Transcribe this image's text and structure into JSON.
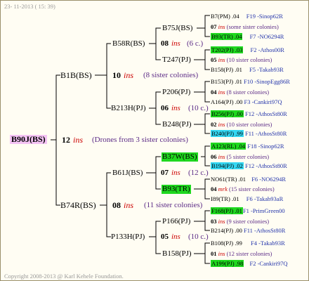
{
  "header": {
    "date": "23- 11-2013 ( 15: 39)"
  },
  "footer": {
    "copyright": "Copyright 2008-2013 @ Karl Kehele Foundation."
  },
  "root": {
    "name": "B90J(BS)",
    "count": "12",
    "ins": "ins",
    "note": "(Drones from 3 sister colonies)"
  },
  "gen1": [
    {
      "name": "B1B(BS)",
      "count": "10",
      "ins": "ins",
      "note": "(8 sister colonies)"
    },
    {
      "name": "B74R(BS)",
      "count": "08",
      "ins": "ins",
      "note": "(11 sister colonies)"
    }
  ],
  "gen2": [
    {
      "name": "B58R(BS)",
      "count": "08",
      "ins": "ins",
      "note": "(6 c.)"
    },
    {
      "name": "B213H(PJ)",
      "count": "06",
      "ins": "ins",
      "note": "(10 c.)"
    },
    {
      "name": "B61J(BS)",
      "count": "07",
      "ins": "ins",
      "note": "(12 c.)"
    },
    {
      "name": "P133H(PJ)",
      "count": "05",
      "ins": "ins",
      "note": "(10 c.)"
    }
  ],
  "gen3": [
    {
      "name": "B75J(BS)"
    },
    {
      "name": "T247(PJ)"
    },
    {
      "name": "P206(PJ)"
    },
    {
      "name": "B248(PJ)"
    },
    {
      "name": "B37W(BS)"
    },
    {
      "name": "B93(TR)"
    },
    {
      "name": "P166(PJ)"
    },
    {
      "name": "B158(PJ)"
    }
  ],
  "right": [
    {
      "main": "B7(PM) .04",
      "code": "F19 -Sinop62R"
    },
    {
      "main": "07",
      "ins": "ins",
      "note": "(some sister colonies)"
    },
    {
      "main": "B93(TR) .04",
      "code": "F7 -NO6294R"
    },
    {
      "main": "T202(PJ) .03",
      "code": "F2 -Athos00R"
    },
    {
      "main": "05",
      "ins": "ins",
      "note": "(10 sister colonies)"
    },
    {
      "main": "B158(PJ) .01",
      "code": "F5 -Takab93R"
    },
    {
      "main": "B153(PJ) .01",
      "code": "F10 -SinopEgg86R"
    },
    {
      "main": "04",
      "ins": "ins",
      "note": "(8 sister colonies)"
    },
    {
      "main": "A164(PJ) .00",
      "code": "F3 -Cankiri97Q"
    },
    {
      "main": "B256(PJ) .00",
      "code": "F12 -AthosSt80R"
    },
    {
      "main": "02",
      "ins": "ins",
      "note": "(10 sister colonies)"
    },
    {
      "main": "B240(PJ) .99",
      "code": "F11 -AthosSt80R"
    },
    {
      "main": "A123(RL) .04",
      "code": "F18 -Sinop62R"
    },
    {
      "main": "06",
      "ins": "ins",
      "note": "(5 sister colonies)"
    },
    {
      "main": "B194(PJ) .02",
      "code": "F12 -AthosSt80R"
    },
    {
      "main": "NO61(TR) .01",
      "code": "F6 -NO6294R"
    },
    {
      "main": "04",
      "ins": "mrk",
      "note": "(15 sister colonies)"
    },
    {
      "main": "I89(TR) .01",
      "code": "F6 -Takab93aR"
    },
    {
      "main": "F168(PJ) .01",
      "code": "F1 -PrimGreen00"
    },
    {
      "main": "03",
      "ins": "ins",
      "note": "(9 sister colonies)"
    },
    {
      "main": "B214(PJ) .00",
      "code": "F11 -AthosSt80R"
    },
    {
      "main": "B108(PJ) .99",
      "code": "F4 -Takab93R"
    },
    {
      "main": "01",
      "ins": "ins",
      "note": "(12 sister colonies)"
    },
    {
      "main": "A199(PJ) .98",
      "code": "F2 -Cankiri97Q"
    }
  ]
}
